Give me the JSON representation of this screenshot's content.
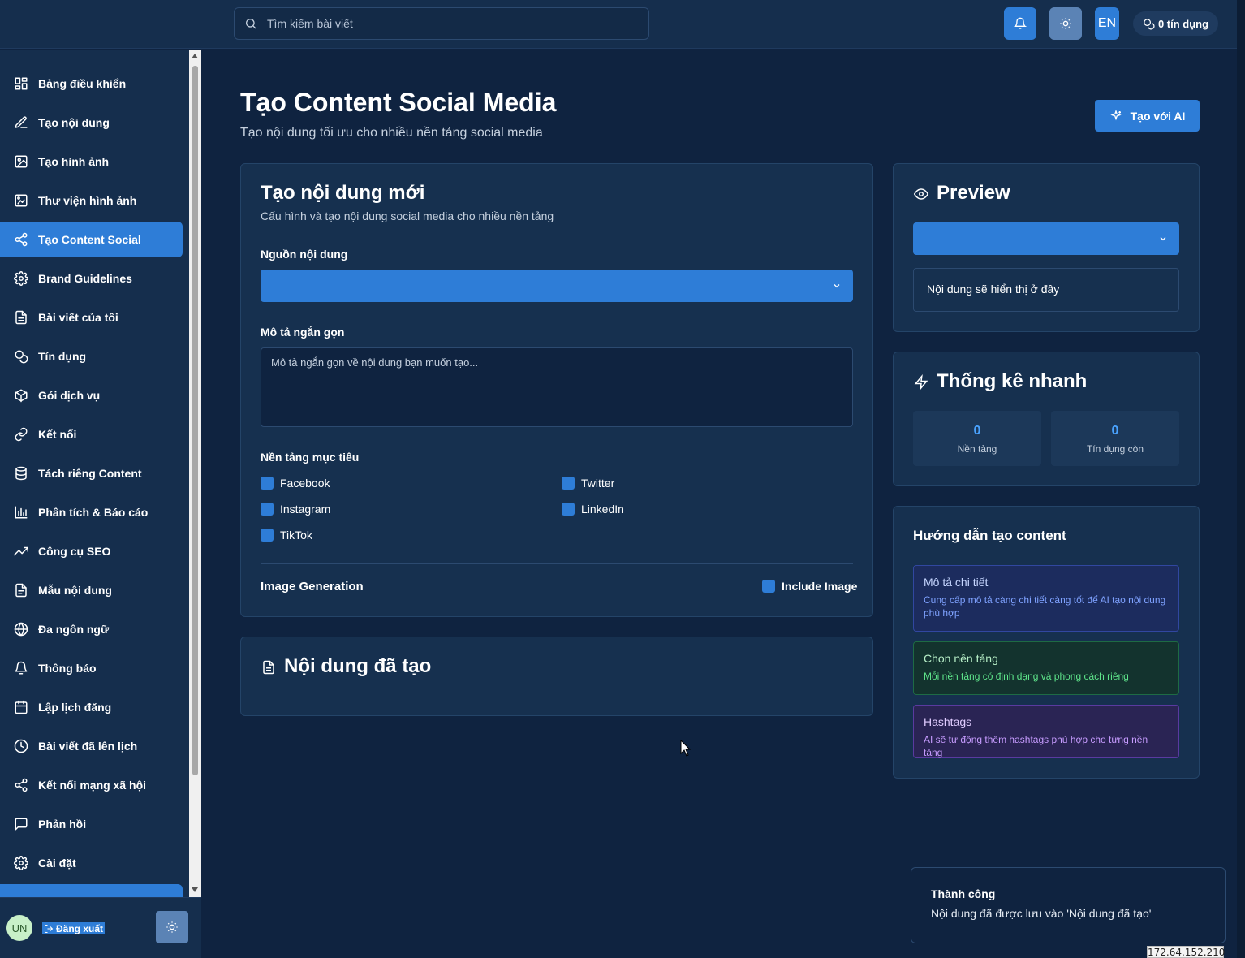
{
  "topbar": {
    "search_placeholder": "Tìm kiếm bài viết",
    "language": "EN",
    "credits": "0 tín dụng"
  },
  "sidebar": {
    "items": [
      {
        "label": "Bảng điều khiển",
        "icon": "dashboard-icon"
      },
      {
        "label": "Tạo nội dung",
        "icon": "edit-icon"
      },
      {
        "label": "Tạo hình ảnh",
        "icon": "image-icon"
      },
      {
        "label": "Thư viện hình ảnh",
        "icon": "gallery-icon"
      },
      {
        "label": "Tạo Content Social",
        "icon": "share-icon",
        "active": true
      },
      {
        "label": "Brand Guidelines",
        "icon": "gear-icon"
      },
      {
        "label": "Bài viết của tôi",
        "icon": "document-icon"
      },
      {
        "label": "Tín dụng",
        "icon": "coins-icon"
      },
      {
        "label": "Gói dịch vụ",
        "icon": "package-icon"
      },
      {
        "label": "Kết nối",
        "icon": "link-icon"
      },
      {
        "label": "Tách riêng Content",
        "icon": "database-icon"
      },
      {
        "label": "Phân tích & Báo cáo",
        "icon": "bar-chart-icon"
      },
      {
        "label": "Công cụ SEO",
        "icon": "trending-up-icon"
      },
      {
        "label": "Mẫu nội dung",
        "icon": "template-icon"
      },
      {
        "label": "Đa ngôn ngữ",
        "icon": "globe-icon"
      },
      {
        "label": "Thông báo",
        "icon": "bell-icon"
      },
      {
        "label": "Lập lịch đăng",
        "icon": "calendar-icon"
      },
      {
        "label": "Bài viết đã lên lịch",
        "icon": "clock-icon"
      },
      {
        "label": "Kết nối mạng xã hội",
        "icon": "share-icon"
      },
      {
        "label": "Phản hồi",
        "icon": "message-icon"
      },
      {
        "label": "Cài đặt",
        "icon": "gear-icon"
      }
    ],
    "avatar": "UN",
    "logout": "Đăng xuất"
  },
  "page": {
    "title": "Tạo Content Social Media",
    "subtitle": "Tạo nội dung tối ưu cho nhiều nền tảng social media",
    "ai_button": "Tạo với AI"
  },
  "form": {
    "title": "Tạo nội dung mới",
    "subtitle": "Cấu hình và tạo nội dung social media cho nhiều nền tảng",
    "source_label": "Nguồn nội dung",
    "source_value": "",
    "desc_label": "Mô tả ngắn gọn",
    "desc_placeholder": "Mô tả ngắn gọn về nội dung bạn muốn tạo...",
    "platforms_label": "Nền tảng mục tiêu",
    "platforms": [
      "Facebook",
      "Twitter",
      "Instagram",
      "LinkedIn",
      "TikTok"
    ],
    "image_gen_label": "Image Generation",
    "include_image": "Include Image"
  },
  "generated": {
    "title": "Nội dung đã tạo"
  },
  "preview": {
    "title": "Preview",
    "select_value": "",
    "placeholder": "Nội dung sẽ hiển thị ở đây"
  },
  "stats": {
    "title": "Thống kê nhanh",
    "platforms_value": "0",
    "platforms_label": "Nền tảng",
    "credits_value": "0",
    "credits_label": "Tín dụng còn"
  },
  "guide": {
    "title": "Hướng dẫn tạo content",
    "tips": [
      {
        "title": "Mô tả chi tiết",
        "desc": "Cung cấp mô tả càng chi tiết càng tốt để AI tạo nội dung phù hợp"
      },
      {
        "title": "Chọn nền tảng",
        "desc": "Mỗi nền tảng có định dạng và phong cách riêng"
      },
      {
        "title": "Hashtags",
        "desc": "AI sẽ tự động thêm hashtags phù hợp cho từng nền tảng"
      }
    ]
  },
  "toast": {
    "title": "Thành công",
    "message": "Nội dung đã được lưu vào 'Nội dung đã tạo'"
  },
  "ip_label": "172.64.152.210",
  "colors": {
    "background": "#0f2340",
    "card": "#16304f",
    "accent": "#2e7dd7"
  }
}
